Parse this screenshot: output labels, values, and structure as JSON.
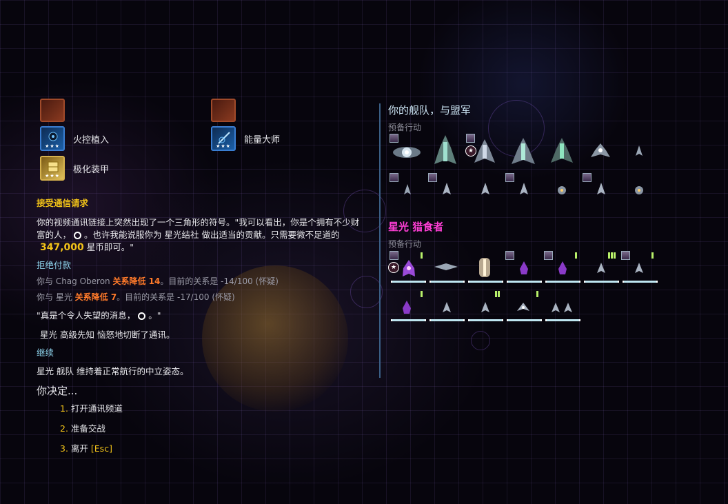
{
  "skills": [
    {
      "name": "火控植入",
      "icon": "targeting-implant-icon",
      "stars": "★★★"
    },
    {
      "name": "能量大师",
      "icon": "energy-master-icon",
      "stars": "★★★"
    },
    {
      "name": "极化装甲",
      "icon": "polarized-armor-icon",
      "stars": "★★★"
    }
  ],
  "dialog": {
    "heading": "接受通信请求",
    "message_1": "你的视频通讯链接上突然出现了一个三角形的符号。\"我可以看出，你是个拥有不少财",
    "message_2": "富的人，",
    "message_3": "。也许我能说服你为 星光结社 做出适当的贡献。只需要微不足道的",
    "amount": "347,000",
    "message_4": " 星币即可。\"",
    "refuse_label": "拒绝付款",
    "rel1_prefix": "你与 Chag Oberon ",
    "rel1_change": "关系降低 14",
    "rel1_suffix": "。目前的关系是 -14/100 (怀疑)",
    "rel2_prefix": "你与 星光 ",
    "rel2_change": "关系降低 7",
    "rel2_suffix": "。目前的关系是 -17/100 (怀疑)",
    "quote_1": "\"真是个令人失望的消息，",
    "quote_2": "。\"",
    "cutoff": "星光 高级先知 恼怒地切断了通讯。",
    "continue_label": "继续",
    "neutral": "星光 舰队 维持着正常航行的中立姿态。",
    "decide": "你决定..."
  },
  "options": [
    {
      "num": "1.",
      "label": "打开通讯频道"
    },
    {
      "num": "2.",
      "label": "准备交战"
    },
    {
      "num": "3.",
      "label": "离开 ",
      "key": "[Esc]"
    }
  ],
  "fleet_panel": {
    "title": "你的舰队，与盟军",
    "subtitle": "预备行动"
  },
  "enemy_panel": {
    "title": "星光 猎食者",
    "subtitle": "预备行动"
  },
  "badge_symbol": "★",
  "colors": {
    "gold": "#f2c318",
    "cyan": "#8fd5ee",
    "orange": "#ff7a2a",
    "enemy_title": "#ff3fd6",
    "fleet_title": "#cfe8f7"
  }
}
